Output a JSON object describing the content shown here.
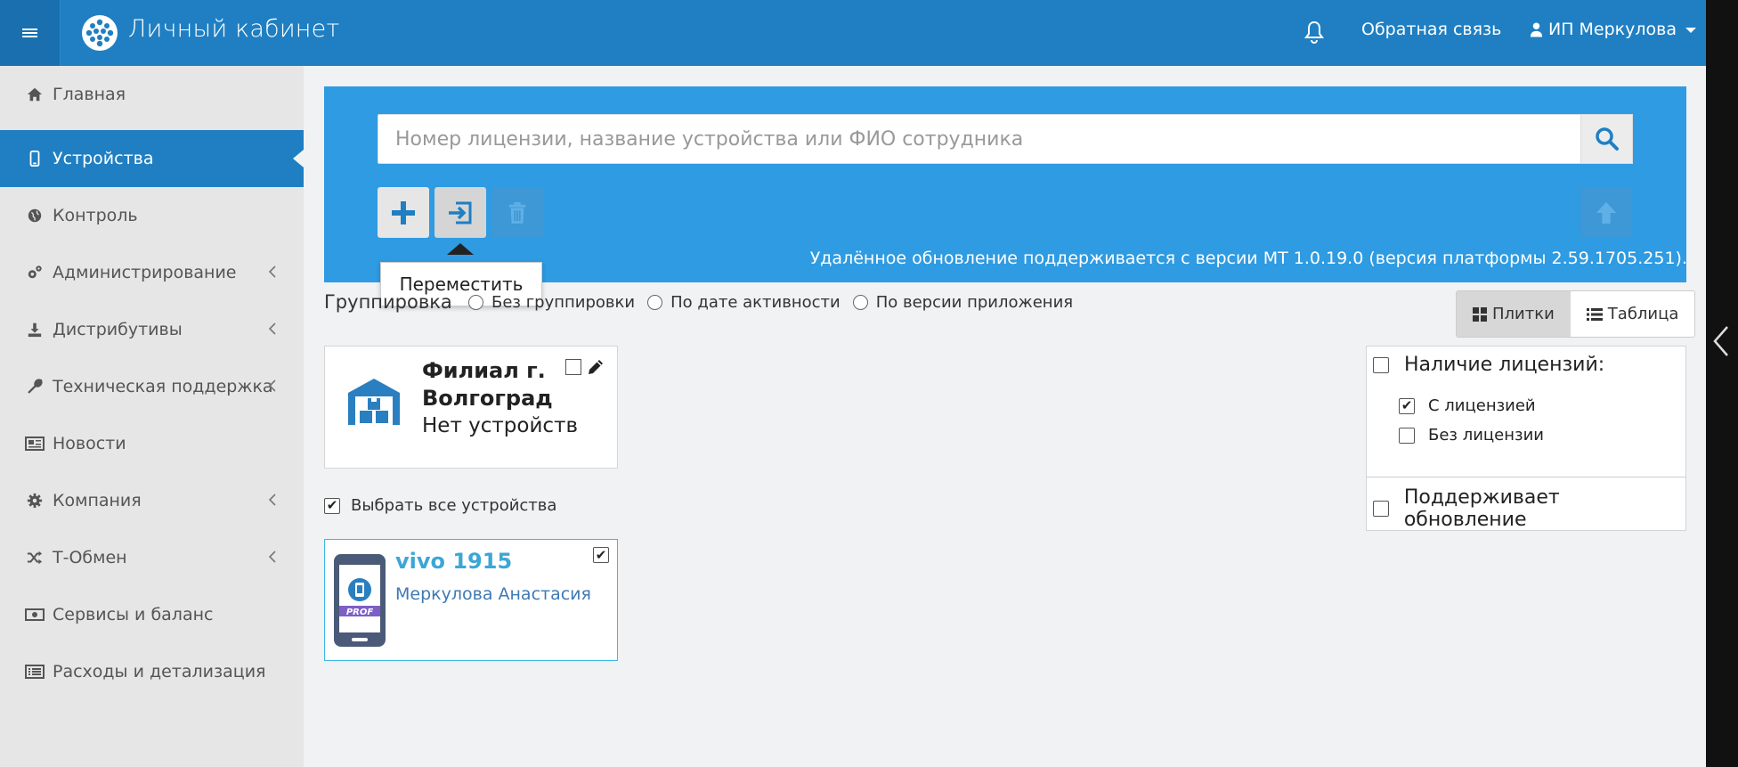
{
  "header": {
    "title": "Личный кабинет",
    "feedback": "Обратная связь",
    "user": "ИП Меркулова"
  },
  "sidebar": {
    "items": [
      {
        "label": "Главная",
        "icon": "home-icon",
        "has_submenu": false,
        "active": false
      },
      {
        "label": "Устройства",
        "icon": "mobile-icon",
        "has_submenu": false,
        "active": true
      },
      {
        "label": "Контроль",
        "icon": "globe-icon",
        "has_submenu": false,
        "active": false
      },
      {
        "label": "Администрирование",
        "icon": "gears-icon",
        "has_submenu": true,
        "active": false
      },
      {
        "label": "Дистрибутивы",
        "icon": "download-icon",
        "has_submenu": true,
        "active": false
      },
      {
        "label": "Техническая поддержка",
        "icon": "wrench-icon",
        "has_submenu": true,
        "active": false
      },
      {
        "label": "Новости",
        "icon": "newspaper-icon",
        "has_submenu": false,
        "active": false
      },
      {
        "label": "Компания",
        "icon": "gear-icon",
        "has_submenu": true,
        "active": false
      },
      {
        "label": "Т-Обмен",
        "icon": "shuffle-icon",
        "has_submenu": true,
        "active": false
      },
      {
        "label": "Сервисы и баланс",
        "icon": "money-icon",
        "has_submenu": false,
        "active": false
      },
      {
        "label": "Расходы и детализация",
        "icon": "list-alt-icon",
        "has_submenu": false,
        "active": false
      }
    ]
  },
  "search": {
    "placeholder": "Номер лицензии, название устройства или ФИО сотрудника",
    "value": ""
  },
  "toolbar": {
    "tooltip": "Переместить",
    "update_note": "Удалённое обновление поддерживается с версии МТ 1.0.19.0 (версия платформы 2.59.1705.251)."
  },
  "grouping": {
    "label": "Группировка",
    "options": [
      "Без группировки",
      "По дате активности",
      "По версии приложения"
    ]
  },
  "view": {
    "tiles": "Плитки",
    "table": "Таблица"
  },
  "group": {
    "name": "Филиал г. Волгоград",
    "status": "Нет устройств"
  },
  "select_all": {
    "label": "Выбрать все устройства",
    "checked": true
  },
  "device": {
    "name": "vivo 1915",
    "employee": "Меркулова Анастасия",
    "badge": "PROF",
    "checked": true
  },
  "filters": {
    "license_title": "Наличие лицензий:",
    "with_license": "С лицензией",
    "without_license": "Без лицензии",
    "update_title": "Поддерживает обновление",
    "with_license_checked": true,
    "without_license_checked": false
  },
  "colors": {
    "header": "#1f7fc2",
    "panel": "#2e9be2",
    "accent": "#3ca6d6",
    "sidebar": "#e6e6e6"
  }
}
